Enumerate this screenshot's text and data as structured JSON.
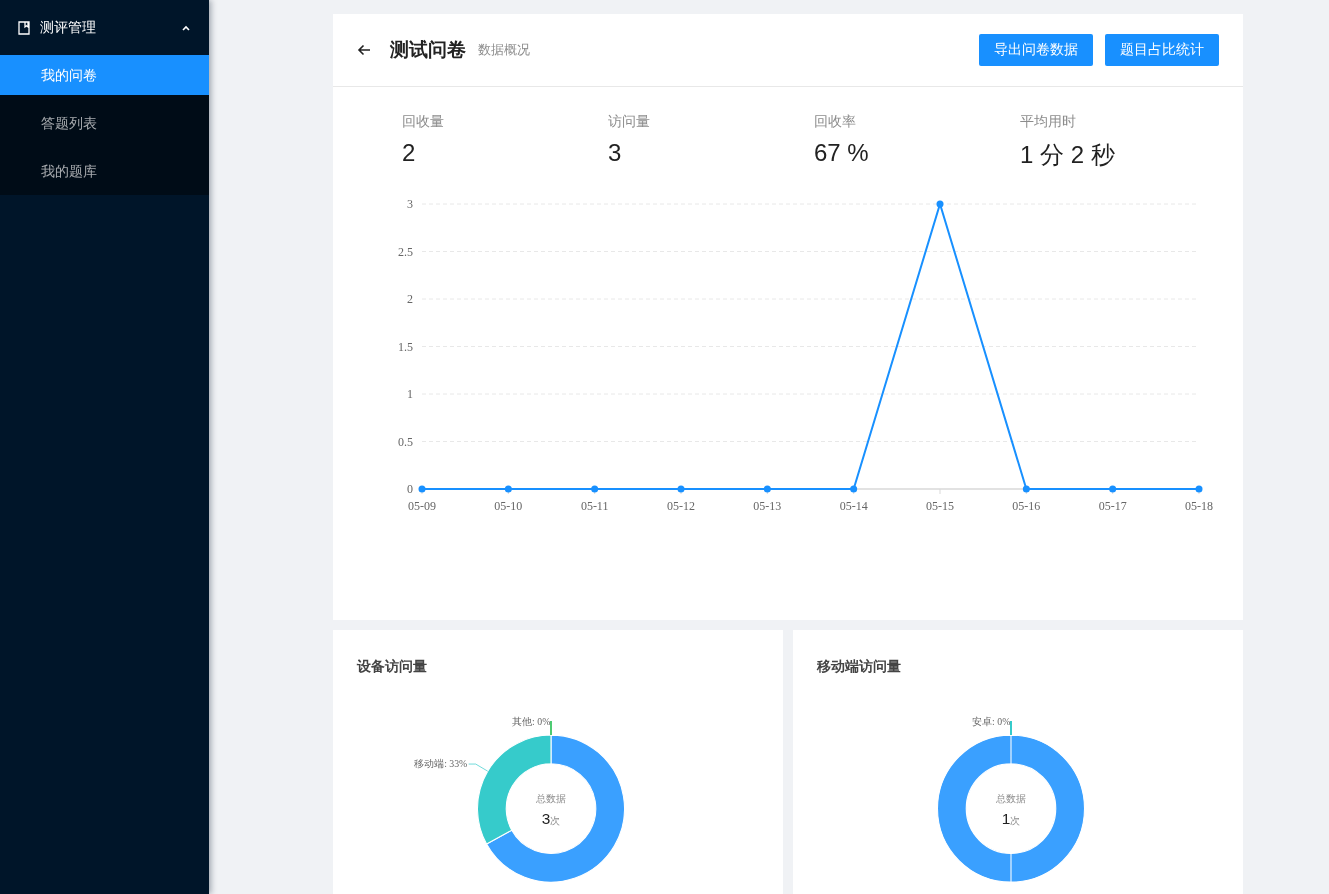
{
  "sidebar": {
    "group": {
      "label": "测评管理",
      "expanded": true
    },
    "items": [
      {
        "label": "我的问卷",
        "selected": true
      },
      {
        "label": "答题列表",
        "selected": false
      },
      {
        "label": "我的题库",
        "selected": false
      }
    ]
  },
  "header": {
    "title": "测试问卷",
    "subtitle": "数据概况",
    "buttons": [
      "导出问卷数据",
      "题目占比统计"
    ]
  },
  "stats": [
    {
      "label": "回收量",
      "value": "2"
    },
    {
      "label": "访问量",
      "value": "3"
    },
    {
      "label": "回收率",
      "value": "67 %"
    },
    {
      "label": "平均用时",
      "value": "1 分 2 秒"
    }
  ],
  "trend": {
    "chart_data": {
      "type": "line",
      "categories": [
        "05-09",
        "05-10",
        "05-11",
        "05-12",
        "05-13",
        "05-14",
        "05-15",
        "05-16",
        "05-17",
        "05-18"
      ],
      "ylim": [
        0,
        3
      ],
      "yticks": [
        0,
        {
          "value": 0.5,
          "label": "0.5"
        },
        1,
        {
          "value": 1.5,
          "label": "1.5"
        },
        2,
        {
          "value": 2.5,
          "label": "2.5"
        },
        3
      ],
      "grid": true,
      "series": [
        {
          "color": "#1890ff",
          "marker": true,
          "values": [
            0,
            0,
            0,
            0,
            0,
            0,
            3,
            0,
            0,
            0
          ]
        }
      ]
    }
  },
  "donuts": [
    {
      "title": "设备访问量",
      "center_label": "总数据",
      "total": "3",
      "unit": "次",
      "slices": [
        {
          "kind": "remainder",
          "color": "#3aa0ff"
        },
        {
          "kind": "labeled",
          "name": "移动端:",
          "percent": "33%",
          "color": "#36cbcb"
        },
        {
          "kind": "labeled",
          "name": "其他:",
          "percent": "0%",
          "color": "#4ecb73"
        }
      ]
    },
    {
      "title": "移动端访问量",
      "center_label": "总数据",
      "total": "1",
      "unit": "次",
      "slices": [
        {
          "kind": "remainder",
          "color": "#3aa0ff"
        },
        {
          "kind": "labeled",
          "name": "安卓:",
          "percent": "0%",
          "color": "#36cbcb"
        }
      ]
    }
  ]
}
